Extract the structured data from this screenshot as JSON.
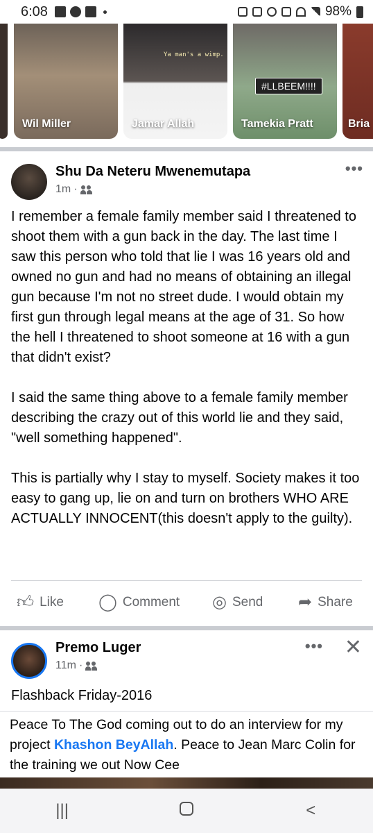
{
  "status_bar": {
    "time": "6:08",
    "battery": "98%"
  },
  "stories": [
    {
      "name": "Wil Miller"
    },
    {
      "name": "Jamar Allah",
      "caption": "Ya man's a wimp."
    },
    {
      "name": "Tamekia Pratt",
      "tag": "#LLBEEM!!!!"
    },
    {
      "name": "Bria"
    }
  ],
  "post1": {
    "author": "Shu Da Neteru Mwenemutapa",
    "time": "1m",
    "audience_icon": "friends-icon",
    "paragraphs": [
      "I remember a female family member said I threatened to shoot them with a gun back in the day. The last time I saw this person who told that lie I was 16 years old and owned no gun and had no means of obtaining an illegal gun because I'm not no street dude. I would obtain my first gun through legal means at the age of 31. So how the hell I threatened to shoot someone at 16 with a gun that didn't exist?",
      "I said the same thing above to a female family member describing the crazy out of this world lie and they said, \"well something happened\".",
      "This is partially why I stay to myself. Society makes it too easy to gang up, lie on and turn on brothers WHO ARE ACTUALLY INNOCENT(this doesn't apply to the guilty)."
    ],
    "actions": {
      "like": "Like",
      "comment": "Comment",
      "send": "Send",
      "share": "Share"
    }
  },
  "post2": {
    "author": "Premo Luger",
    "time": "11m",
    "title": "Flashback Friday-2016",
    "shared_text_before": "Peace To The God coming out to do an interview for my project ",
    "shared_link": "Khashon BeyAllah",
    "shared_text_after": ". Peace to Jean Marc Colin for the training we out Now Cee"
  },
  "colors": {
    "link": "#1877f2",
    "secondary_text": "#65676b",
    "divider": "#c9ccd1"
  }
}
